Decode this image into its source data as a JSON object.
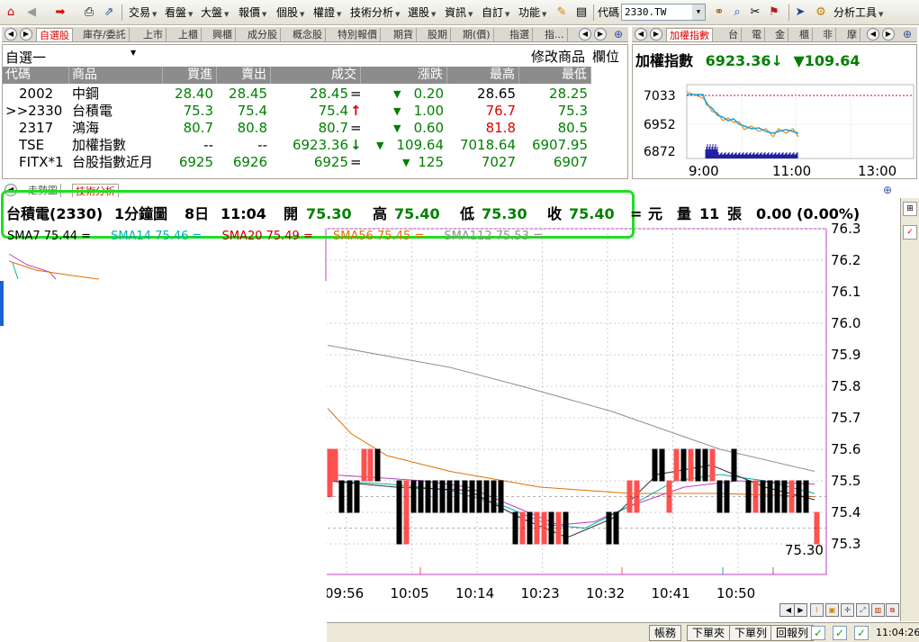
{
  "toolbar": {
    "menus": [
      "交易",
      "看盤",
      "大盤",
      "報價",
      "個股",
      "權證",
      "技術分析",
      "選股",
      "資訊",
      "自訂",
      "功能"
    ],
    "code_label": "代碼",
    "code_value": "2330.TW",
    "analysis_tools": "分析工具"
  },
  "watch_tabs": [
    "自選股",
    "庫存/委託",
    "上市",
    "上櫃",
    "興櫃",
    "成分股",
    "概念股",
    "特別報價",
    "期貨",
    "股期",
    "期(價)",
    "指選",
    "指..."
  ],
  "index_tabs": [
    "加權指數",
    "台",
    "電",
    "金",
    "櫃",
    "非",
    "摩"
  ],
  "watchlist": {
    "group_name": "自選一",
    "modify_label": "修改商品",
    "fields_label": "欄位",
    "columns": [
      "代碼",
      "商品",
      "買進",
      "賣出",
      "成交",
      "漲跌",
      "最高",
      "最低"
    ],
    "rows": [
      {
        "code": "2002",
        "name": "中鋼",
        "bid": "28.40",
        "ask": "28.45",
        "last": "28.45",
        "mark": "=",
        "change": "0.20",
        "high": "28.65",
        "low": "28.25"
      },
      {
        "code": ">>2330",
        "name": "台積電",
        "bid": "75.3",
        "ask": "75.4",
        "last": "75.4",
        "mark": "↑",
        "change": "1.00",
        "high": "76.7",
        "low": "75.3"
      },
      {
        "code": "2317",
        "name": "鴻海",
        "bid": "80.7",
        "ask": "80.8",
        "last": "80.7",
        "mark": "=",
        "change": "0.60",
        "high": "81.8",
        "low": "80.5"
      },
      {
        "code": "TSE",
        "name": "加權指數",
        "bid": "--",
        "ask": "--",
        "last": "6923.36",
        "mark": "↓",
        "change": "109.64",
        "high": "7018.64",
        "low": "6907.95"
      },
      {
        "code": "FITX*1",
        "name": "台股指數近月",
        "bid": "6925",
        "ask": "6926",
        "last": "6925",
        "mark": "=",
        "change": "125",
        "high": "7027",
        "low": "6907"
      }
    ]
  },
  "index_panel": {
    "title": "加權指數",
    "value": "6923.36",
    "change": "▼109.64",
    "y_labels": [
      "7033",
      "6952",
      "6872"
    ],
    "x_labels": [
      "9:00",
      "11:00",
      "13:00"
    ]
  },
  "main_tabs": [
    "走勢圖",
    "技術分析"
  ],
  "info": {
    "name": "台積電(2330)",
    "period": "1分鐘圖",
    "day": "8日",
    "time": "11:04",
    "open_label": "開",
    "open": "75.30",
    "high_label": "高",
    "high": "75.40",
    "low_label": "低",
    "low": "75.30",
    "close_label": "收",
    "close": "75.40",
    "eq": "=",
    "unit": "元",
    "vol_label": "量",
    "vol": "11",
    "vol_unit": "張",
    "chg": "0.00 (0.00%)"
  },
  "sma": [
    {
      "label": "SMA7 75.44 =",
      "color": "#000000"
    },
    {
      "label": "SMA14 75.46 =",
      "color": "#00b0b0"
    },
    {
      "label": "SMA20 75.49 =",
      "color": "#c00000"
    },
    {
      "label": "SMA56 75.45 =",
      "color": "#e07000"
    },
    {
      "label": "SMA112 75.53 =",
      "color": "#909090"
    }
  ],
  "chart_data": {
    "type": "candlestick",
    "y_labels": [
      "76.3",
      "76.2",
      "76.1",
      "76.0",
      "75.9",
      "75.8",
      "75.7",
      "75.6",
      "75.5",
      "75.4",
      "75.3"
    ],
    "x_labels": [
      "09:56",
      "10:05",
      "10:14",
      "10:23",
      "10:32",
      "10:41",
      "10:50"
    ],
    "ylim": [
      75.3,
      76.3
    ],
    "last_price": "75.30"
  },
  "statusbar": {
    "buttons": [
      "帳務",
      "下單夾",
      "下單列",
      "回報列"
    ],
    "clock": "11:04:26"
  }
}
